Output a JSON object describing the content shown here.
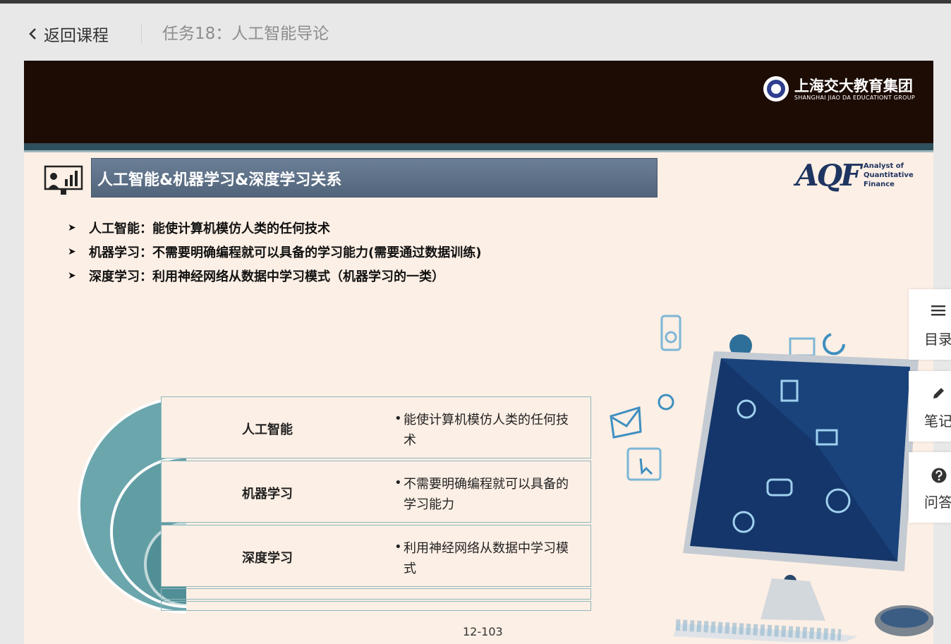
{
  "header": {
    "back_label": "返回课程",
    "course_title": "任务18：人工智能导论"
  },
  "slide": {
    "banner_logo_cn": "上海交大教育集团",
    "banner_logo_en": "SHANGHAI JIAO DA EDUCATIONT GROUP",
    "title": "人工智能&机器学习&深度学习关系",
    "aqf_big": "AQF",
    "aqf_line1": "Analyst of",
    "aqf_line2": "Quantitative Finance",
    "bullets": [
      "人工智能：能使计算机模仿人类的任何技术",
      "机器学习：不需要明确编程就可以具备的学习能力(需要通过数据训练)",
      "深度学习：利用神经网络从数据中学习模式（机器学习的一类）"
    ],
    "table": [
      {
        "label": "人工智能",
        "desc": "能使计算机模仿人类的任何技术"
      },
      {
        "label": "机器学习",
        "desc": "不需要明确编程就可以具备的学习能力"
      },
      {
        "label": "深度学习",
        "desc": "利用神经网络从数据中学习模式"
      }
    ],
    "page_number": "12-103"
  },
  "side_panel": {
    "toc_label": "目录",
    "notes_label": "笔记",
    "qa_label": "问答"
  },
  "icons": {
    "back": "chevron-left-icon",
    "toc": "menu-icon",
    "notes": "pencil-icon",
    "qa": "question-icon"
  },
  "colors": {
    "banner": "#1c0c04",
    "slide_bg": "#fcefe5",
    "title_bar": "#5b6e85",
    "teal": "#6ba6ad"
  }
}
